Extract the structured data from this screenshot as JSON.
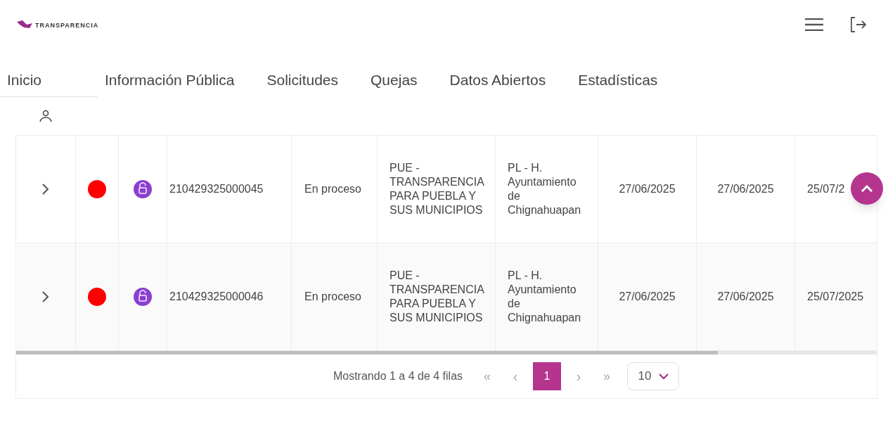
{
  "logo": {
    "text": "TRANSPARENCIA"
  },
  "nav": [
    {
      "label": "Inicio",
      "selected": true
    },
    {
      "label": "Información Pública",
      "selected": false
    },
    {
      "label": "Solicitudes",
      "selected": false
    },
    {
      "label": "Quejas",
      "selected": false
    },
    {
      "label": "Datos Abiertos",
      "selected": false
    },
    {
      "label": "Estadísticas",
      "selected": false
    }
  ],
  "rows": [
    {
      "color": "#ff0000",
      "folio": "210429325000045",
      "estado": "En proceso",
      "column_6": "PUE - TRANSPARENCIA PARA PUEBLA Y SUS MUNICIPIOS",
      "column_7": "PL - H. Ayuntamiento de Chignahuapan",
      "column_8": "27/06/2025",
      "column_9": "27/06/2025",
      "column_10": "25/07/2"
    },
    {
      "color": "#ff0000",
      "folio": "210429325000046",
      "estado": "En proceso",
      "column_6": "PUE - TRANSPARENCIA PARA PUEBLA Y SUS MUNICIPIOS",
      "column_7": "PL - H. Ayuntamiento de Chignahuapan",
      "column_8": "27/06/2025",
      "column_9": "27/06/2025",
      "column_10": "25/07/2025"
    }
  ],
  "pagination": {
    "summary": "Mostrando 1 a 4 de 4 filas",
    "first": "«",
    "prev": "‹",
    "pages": [
      {
        "label": "1",
        "selected": true
      }
    ],
    "next": "›",
    "last": "»",
    "page_size": "10"
  }
}
